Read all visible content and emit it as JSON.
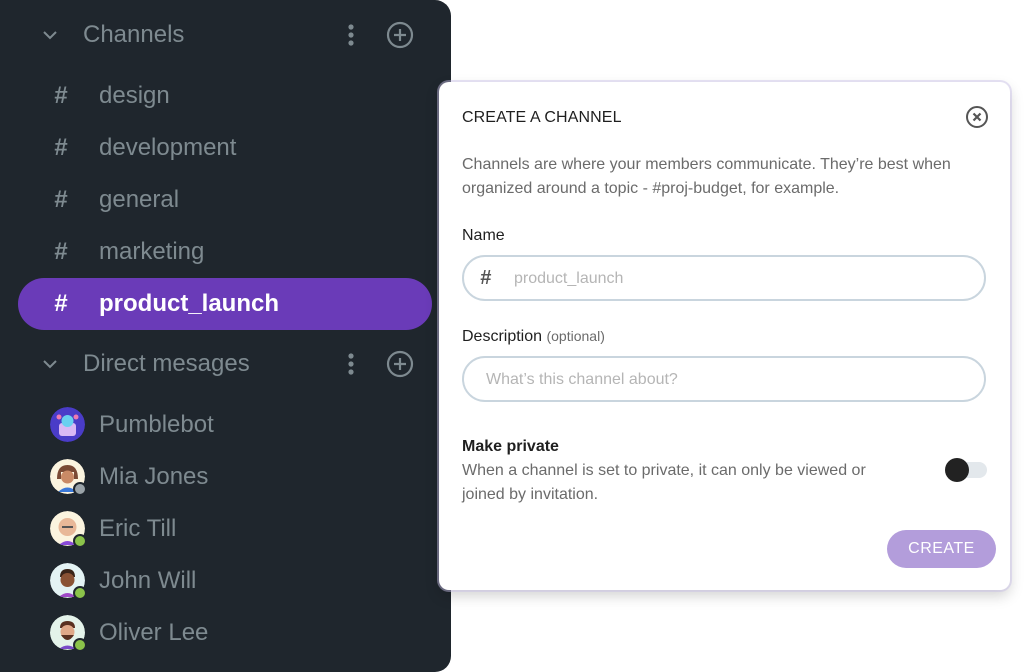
{
  "sidebar": {
    "channels_section": {
      "title": "Channels"
    },
    "channels": [
      {
        "label": "design",
        "active": false
      },
      {
        "label": "development",
        "active": false
      },
      {
        "label": "general",
        "active": false
      },
      {
        "label": "marketing",
        "active": false
      },
      {
        "label": "product_launch",
        "active": true
      }
    ],
    "channel_prefix": "#",
    "dm_section": {
      "title": "Direct mesages"
    },
    "direct_messages": [
      {
        "label": "Pumblebot",
        "status": "none"
      },
      {
        "label": "Mia Jones",
        "status": "offline"
      },
      {
        "label": "Eric Till",
        "status": "away"
      },
      {
        "label": "John Will",
        "status": "online"
      },
      {
        "label": "Oliver Lee",
        "status": "away"
      }
    ]
  },
  "modal": {
    "title": "CREATE A CHANNEL",
    "description": "Channels are where your members communicate. They’re best when organized around a topic - #proj-budget, for example.",
    "name_label": "Name",
    "name_prefix": "#",
    "name_placeholder": "product_launch",
    "name_value": "",
    "description_label": "Description",
    "description_optional": "(optional)",
    "description_placeholder": "What’s this channel about?",
    "description_value": "",
    "private_title": "Make private",
    "private_desc": "When a channel is set to private, it can only be viewed or joined by invitation.",
    "private_enabled": false,
    "create_label": "CREATE"
  },
  "colors": {
    "sidebar_bg": "#1f262d",
    "accent": "#6a3bb8",
    "create_button": "#b39ddb",
    "status_online": "#8bc34a",
    "status_offline": "#9aa3a8"
  }
}
